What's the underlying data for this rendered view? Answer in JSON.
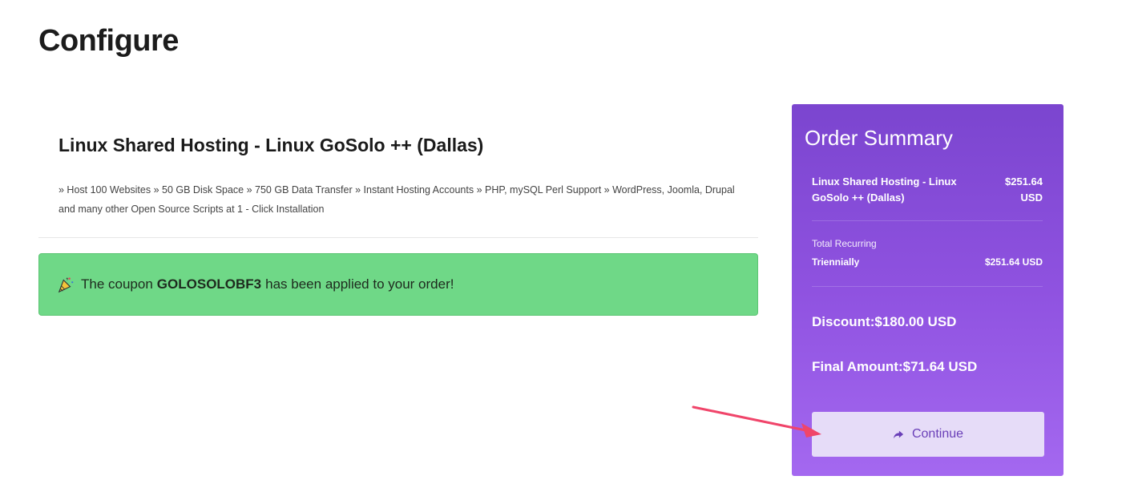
{
  "page": {
    "title": "Configure"
  },
  "product": {
    "name": "Linux Shared Hosting - Linux GoSolo ++ (Dallas)",
    "description": "» Host 100 Websites » 50 GB Disk Space » 750 GB Data Transfer » Instant Hosting Accounts » PHP, mySQL Perl Support » WordPress, Joomla, Drupal and many other Open Source Scripts at 1 - Click Installation"
  },
  "coupon": {
    "prefix": "The coupon",
    "code": "GOLOSOLOBF3",
    "suffix": "has been applied to your order!",
    "icon": "party-popper-icon"
  },
  "summary": {
    "title": "Order Summary",
    "item_name": "Linux Shared Hosting - Linux GoSolo ++ (Dallas)",
    "item_price": "$251.64 USD",
    "recurring_label": "Total Recurring",
    "recurring_cycle": "Triennially",
    "recurring_amount": "$251.64 USD",
    "discount": "Discount:$180.00 USD",
    "final_amount": "Final Amount:$71.64 USD",
    "continue_label": "Continue"
  },
  "colors": {
    "summary_gradient_top": "#7b45cf",
    "summary_gradient_bottom": "#a468f0",
    "alert_green": "#6fd887",
    "button_bg": "#e6dcf8",
    "button_text": "#6a3fb8",
    "pointer_arrow": "#f0456a"
  }
}
